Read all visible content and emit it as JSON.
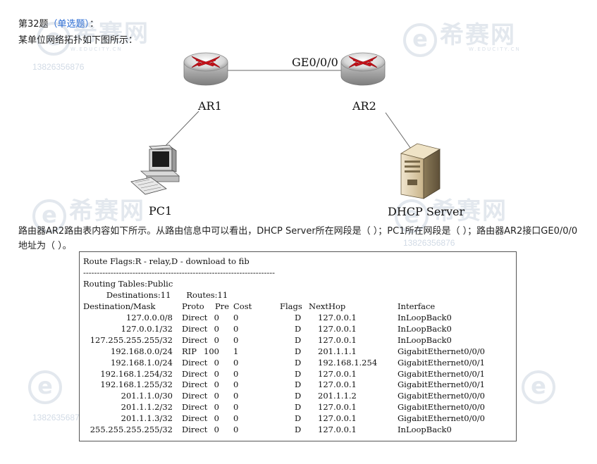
{
  "question": {
    "number_label": "第32题",
    "type_label": "（单选题）",
    "suffix": "：",
    "intro": "某单位网络拓扑如下图所示：",
    "description": "路由器AR2路由表内容如下所示。从路由信息中可以看出，DHCP Server所在网段是（    ）；PC1所在网段是（    ）；路由器AR2接口GE0/0/0地址为（    ）。"
  },
  "topology": {
    "link_label": "GE0/0/0",
    "nodes": {
      "ar1": "AR1",
      "ar2": "AR2",
      "pc1": "PC1",
      "dhcp": "DHCP Server"
    }
  },
  "watermark": {
    "brand": "希赛网",
    "phone": "13826356876",
    "url": "W.EDUCITY.CN"
  },
  "route_table": {
    "flags_line": "Route Flags:R - relay,D - download to fib",
    "separator": "----------------------------------------------------------------------",
    "tables_line": "Routing Tables:Public",
    "summary_line": "         Destinations:11      Routes:11",
    "headers": [
      "Destination/Mask",
      "Proto",
      "Pre",
      "Cost",
      "Flags",
      "NextHop",
      "Interface"
    ],
    "rows": [
      [
        "127.0.0.0/8",
        "Direct",
        "0",
        "0",
        "D",
        "127.0.0.1",
        "InLoopBack0"
      ],
      [
        "127.0.0.1/32",
        "Direct",
        "0",
        "0",
        "D",
        "127.0.0.1",
        "InLoopBack0"
      ],
      [
        "127.255.255.255/32",
        "Direct",
        "0",
        "0",
        "D",
        "127.0.0.1",
        "InLoopBack0"
      ],
      [
        "192.168.0.0/24",
        "RIP",
        "100",
        "1",
        "D",
        "201.1.1.1",
        "GigabitEthernet0/0/0"
      ],
      [
        "192.168.1.0/24",
        "Direct",
        "0",
        "0",
        "D",
        "192.168.1.254",
        "GigabitEthernet0/0/1"
      ],
      [
        "192.168.1.254/32",
        "Direct",
        "0",
        "0",
        "D",
        "127.0.0.1",
        "GigabitEthernet0/0/1"
      ],
      [
        "192.168.1.255/32",
        "Direct",
        "0",
        "0",
        "D",
        "127.0.0.1",
        "GigabitEthernet0/0/1"
      ],
      [
        "201.1.1.0/30",
        "Direct",
        "0",
        "0",
        "D",
        "201.1.1.2",
        "GigabitEthernet0/0/0"
      ],
      [
        "201.1.1.2/32",
        "Direct",
        "0",
        "0",
        "D",
        "127.0.0.1",
        "GigabitEthernet0/0/0"
      ],
      [
        "201.1.1.3/32",
        "Direct",
        "0",
        "0",
        "D",
        "127.0.0.1",
        "GigabitEthernet0/0/0"
      ],
      [
        "255.255.255.255/32",
        "Direct",
        "0",
        "0",
        "D",
        "127.0.0.1",
        "InLoopBack0"
      ]
    ]
  }
}
